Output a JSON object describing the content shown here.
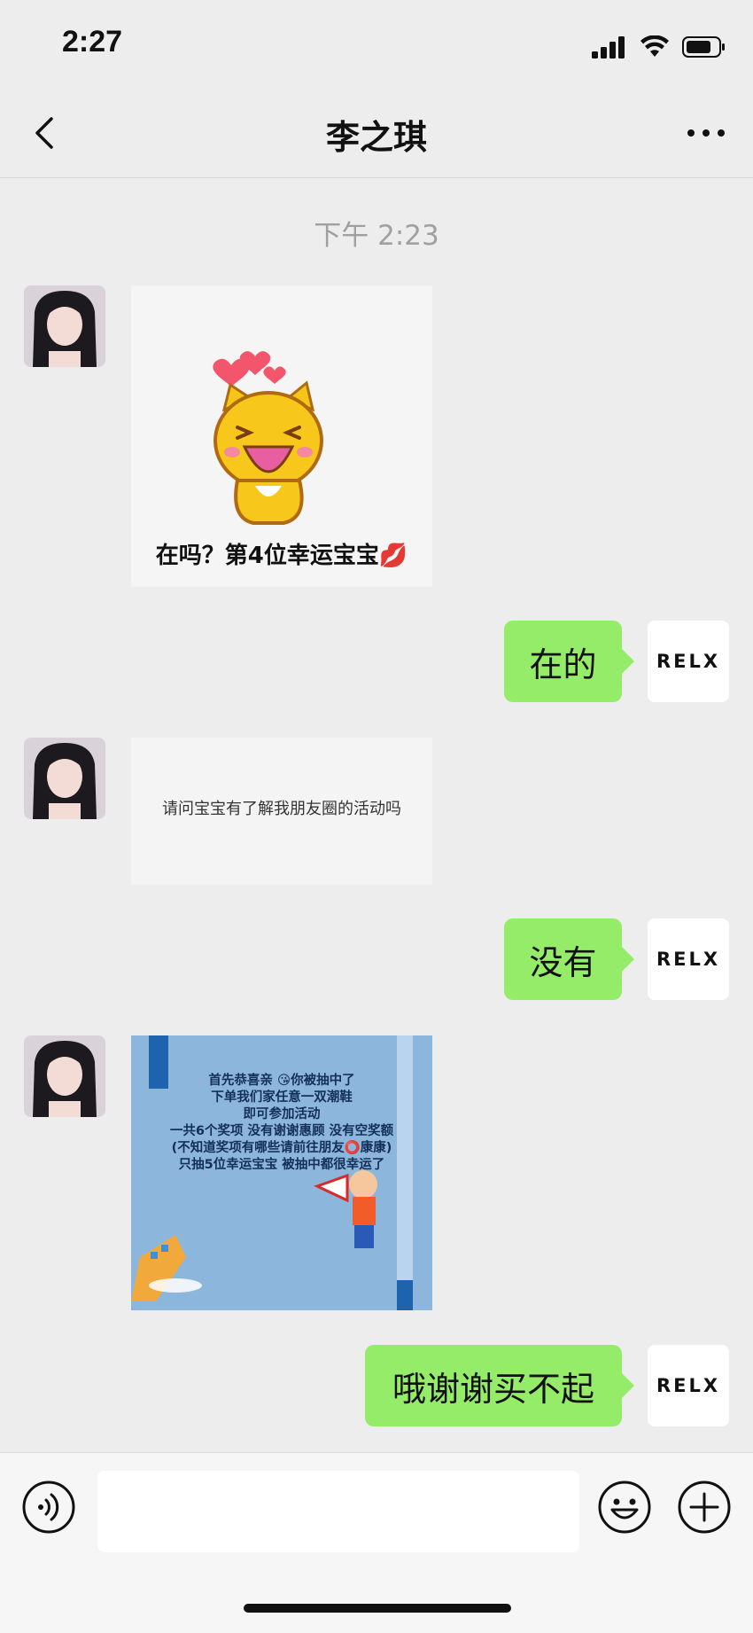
{
  "status_bar": {
    "time": "2:27"
  },
  "nav": {
    "title": "李之琪"
  },
  "chat": {
    "timestamp": "下午 2:23",
    "messages": [
      {
        "side": "left",
        "type": "sticker",
        "caption": "在吗？第4位幸运宝宝💋"
      },
      {
        "side": "right",
        "type": "text",
        "text": "在的",
        "avatar_label": "RELX"
      },
      {
        "side": "left",
        "type": "image",
        "caption": "请问宝宝有了解我朋友圈的活动吗"
      },
      {
        "side": "right",
        "type": "text",
        "text": "没有",
        "avatar_label": "RELX"
      },
      {
        "side": "left",
        "type": "image",
        "caption": "首先恭喜亲 😘你被抽中了\n下单我们家任意一双潮鞋\n即可参加活动\n一共6个奖项 没有谢谢惠顾 没有空奖额\n(不知道奖项有哪些请前往朋友⭕康康)\n只抽5位幸运宝宝 被抽中都很幸运了"
      },
      {
        "side": "right",
        "type": "text",
        "text": "哦谢谢买不起",
        "avatar_label": "RELX"
      }
    ]
  },
  "input_bar": {
    "text_value": ""
  },
  "colors": {
    "bubble_self": "#95ec69",
    "background": "#ededed"
  }
}
